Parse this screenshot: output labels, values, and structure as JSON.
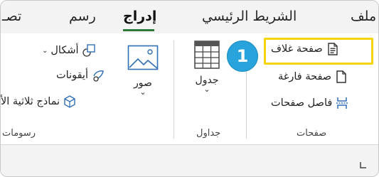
{
  "tabs": {
    "file": "ملف",
    "home": "الشريط الرئيسي",
    "insert": "إدراج",
    "draw": "رسم",
    "design_partial": "تصـ"
  },
  "groups": {
    "pages": {
      "label": "صفحات",
      "cover_page": "صفحة غلاف",
      "blank_page": "صفحة فارغة",
      "page_break": "فاصل صفحات"
    },
    "tables": {
      "label": "جداول",
      "table": "جدول"
    },
    "illustrations": {
      "label": "رسومات",
      "pictures": "صور",
      "shapes": "أشكال",
      "icons": "أيقونات",
      "models_3d": "نماذج ثلاثية الأ"
    }
  },
  "callout": {
    "number": "1"
  },
  "colors": {
    "highlight": "#f6d20a",
    "badge": "#29a3dc",
    "insert_underline": "#2b7a3b"
  }
}
